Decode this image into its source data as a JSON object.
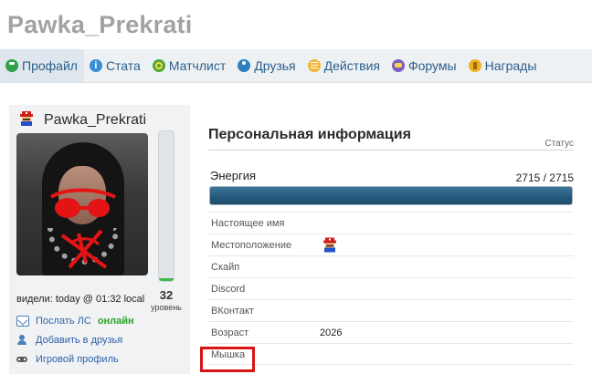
{
  "page": {
    "title": "Pawka_Prekrati"
  },
  "tabs": [
    {
      "label": "Профайл",
      "icon": "profile-icon",
      "active": true
    },
    {
      "label": "Стата",
      "icon": "stats-icon",
      "active": false
    },
    {
      "label": "Матчлист",
      "icon": "matchlist-icon",
      "active": false
    },
    {
      "label": "Друзья",
      "icon": "friends-icon",
      "active": false
    },
    {
      "label": "Действия",
      "icon": "actions-icon",
      "active": false
    },
    {
      "label": "Форумы",
      "icon": "forums-icon",
      "active": false
    },
    {
      "label": "Награды",
      "icon": "awards-icon",
      "active": false
    }
  ],
  "profile": {
    "username": "Pawka_Prekrati",
    "avatar_icon": "mario-avatar-icon",
    "level": "32",
    "level_word": "уровень",
    "level_progress": 0.02,
    "last_seen": "видели: today @ 01:32 local",
    "links": {
      "send_pm": "Послать ЛС",
      "online": "онлайн",
      "add_friend": "Добавить в друзья",
      "game_profile": "Игровой профиль"
    }
  },
  "personal": {
    "title": "Персональная информация",
    "status_label": "Статус",
    "energy_label": "Энергия",
    "energy_value": "2715 / 2715",
    "energy_fraction": 1.0,
    "rows": [
      {
        "label": "Настоящее имя",
        "value": ""
      },
      {
        "label": "Местоположение",
        "value": ""
      },
      {
        "label": "Скайп",
        "value": ""
      },
      {
        "label": "Discord",
        "value": ""
      },
      {
        "label": "ВКонтакт",
        "value": ""
      },
      {
        "label": "Возраст",
        "value": "2026"
      },
      {
        "label": "Мышка",
        "value": ""
      }
    ],
    "location_icon": "mario-flag-icon"
  },
  "colors": {
    "accent": "#2b5f8a",
    "online": "#2aa02a",
    "energy": "#245a7e",
    "level_fill": "#45b649",
    "highlight": "#d81414"
  }
}
